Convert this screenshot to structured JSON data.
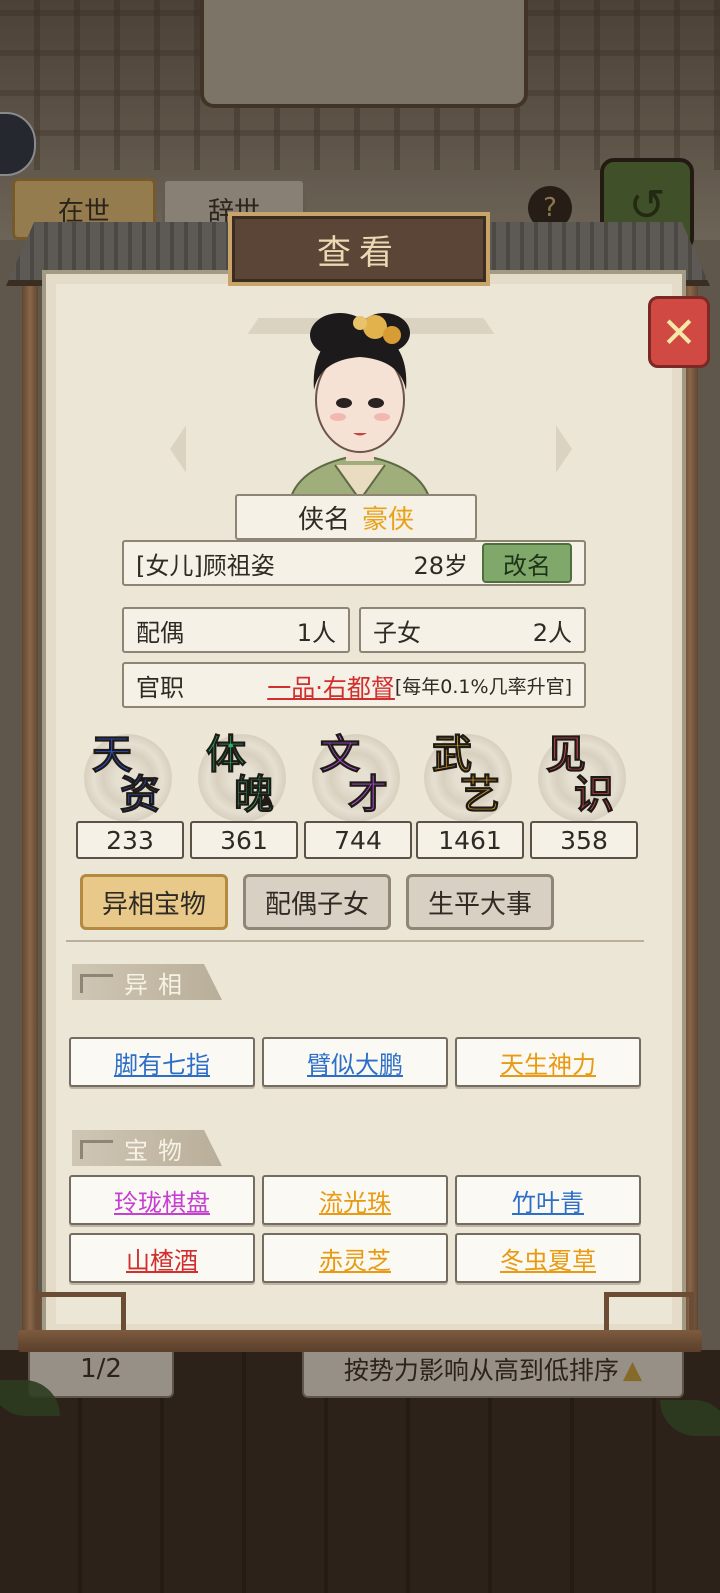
{
  "background": {
    "tabs": [
      "在世",
      "辞世"
    ],
    "help_icon": "?",
    "pager": "1/2",
    "sort_label": "按势力影响从高到低排序"
  },
  "dialog": {
    "title": "查看",
    "close_icon": "close-icon"
  },
  "character": {
    "alias_label": "侠名",
    "alias_value": "豪侠",
    "name": "[女儿]顾祖姿",
    "age": "28岁",
    "rename_button": "改名",
    "spouse_label": "配偶",
    "spouse_count": "1人",
    "children_label": "子女",
    "children_count": "2人",
    "office_label": "官职",
    "office_value": "一品·右都督",
    "office_note": "[每年0.1%几率升官]"
  },
  "stats": [
    {
      "c1": "天",
      "c2": "资",
      "value": "233",
      "color": "#2f55d8"
    },
    {
      "c1": "体",
      "c2": "魄",
      "value": "361",
      "color": "#2fb06a"
    },
    {
      "c1": "文",
      "c2": "才",
      "value": "744",
      "color": "#b14fd8"
    },
    {
      "c1": "武",
      "c2": "艺",
      "value": "1461",
      "color": "#e3a21f"
    },
    {
      "c1": "见",
      "c2": "识",
      "value": "358",
      "color": "#d9495e"
    }
  ],
  "tabs": {
    "active": "异相宝物",
    "spouse_children": "配偶子女",
    "life_events": "生平大事"
  },
  "traits": {
    "heading": "异相",
    "items": [
      {
        "label": "脚有七指",
        "color": "#2d6fc8"
      },
      {
        "label": "臂似大鹏",
        "color": "#2d6fc8"
      },
      {
        "label": "天生神力",
        "color": "#e89a12"
      }
    ]
  },
  "treasures": {
    "heading": "宝物",
    "items": [
      {
        "label": "玲珑棋盘",
        "color": "#c53fd0"
      },
      {
        "label": "流光珠",
        "color": "#e89a12"
      },
      {
        "label": "竹叶青",
        "color": "#2d6fc8"
      },
      {
        "label": "山楂酒",
        "color": "#d12e2e"
      },
      {
        "label": "赤灵芝",
        "color": "#e89a12"
      },
      {
        "label": "冬虫夏草",
        "color": "#e89a12"
      }
    ]
  }
}
